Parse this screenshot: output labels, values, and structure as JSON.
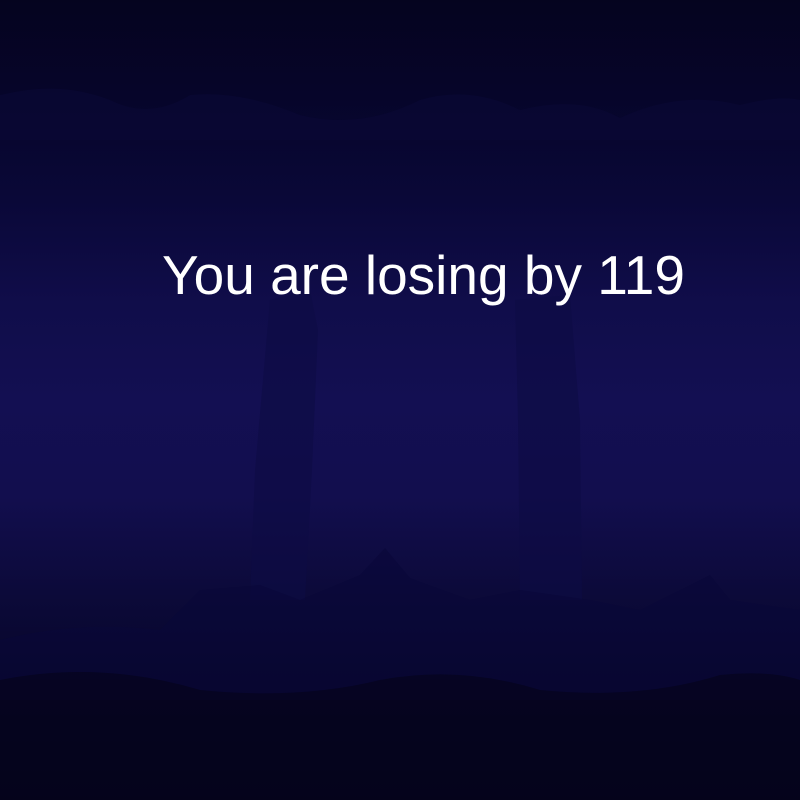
{
  "game": {
    "status_message": "You are losing by 119"
  },
  "colors": {
    "background_top": "#05041f",
    "background_mid": "#130f52",
    "background_bottom": "#04031a",
    "text": "#ffffff"
  }
}
